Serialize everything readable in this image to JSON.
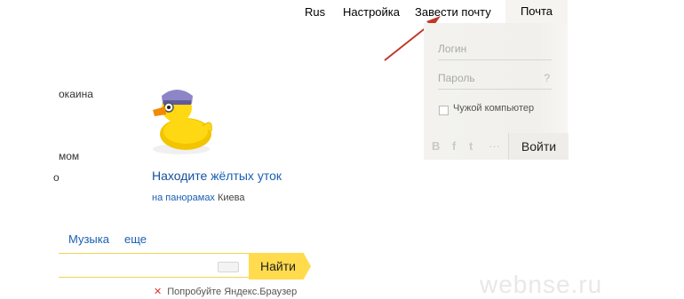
{
  "top_nav": {
    "lang": "Rus",
    "settings": "Настройка",
    "create_mail": "Завести почту",
    "mail_tab": "Почта"
  },
  "login": {
    "login_placeholder": "Логин",
    "password_placeholder": "Пароль",
    "help": "?",
    "remember": "Чужой компьютер",
    "social": [
      "В",
      "f",
      "t",
      "···"
    ],
    "submit": "Войти"
  },
  "left_fragments": [
    "окаина",
    "мом",
    "о"
  ],
  "promo": {
    "title_prefix": "Находите",
    "title_rest": " жёлтых уток",
    "sub_link": "на панорамах",
    "sub_rest": " Киева"
  },
  "search_tabs": [
    "Музыка",
    "еще"
  ],
  "search": {
    "button": "Найти",
    "browser_link": "Попробуйте Яндекс.Браузер"
  },
  "watermark": "webnse.ru"
}
